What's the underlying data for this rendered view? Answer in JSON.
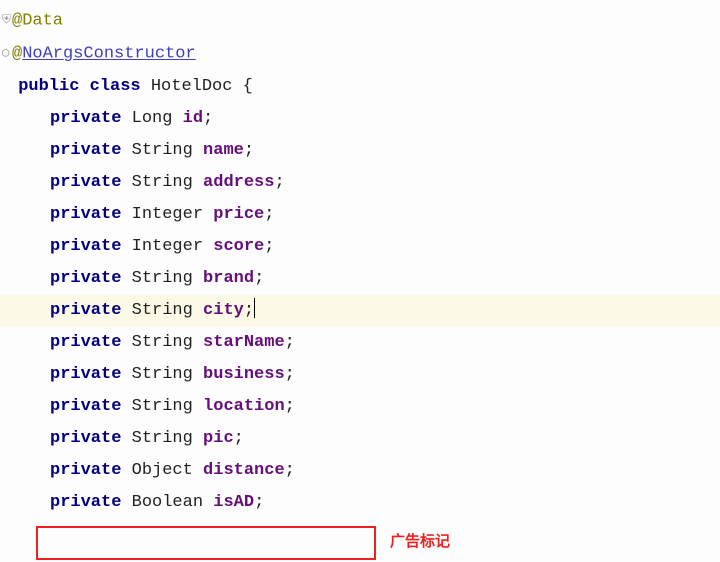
{
  "annotations": {
    "data": "@Data",
    "noargs_at": "@",
    "noargs": "NoArgsConstructor"
  },
  "class_decl": {
    "kw_public": "public",
    "kw_class": "class",
    "name": "HotelDoc",
    "brace": "{"
  },
  "kw_private": "private",
  "fields": [
    {
      "type": "Long",
      "name": "id"
    },
    {
      "type": "String",
      "name": "name"
    },
    {
      "type": "String",
      "name": "address"
    },
    {
      "type": "Integer",
      "name": "price"
    },
    {
      "type": "Integer",
      "name": "score"
    },
    {
      "type": "String",
      "name": "brand"
    },
    {
      "type": "String",
      "name": "city"
    },
    {
      "type": "String",
      "name": "starName"
    },
    {
      "type": "String",
      "name": "business"
    },
    {
      "type": "String",
      "name": "location"
    },
    {
      "type": "String",
      "name": "pic"
    },
    {
      "type": "Object",
      "name": "distance"
    },
    {
      "type": "Boolean",
      "name": "isAD"
    }
  ],
  "semicolon": ";",
  "highlighted_line_index": 6,
  "red_note": "广告标记"
}
